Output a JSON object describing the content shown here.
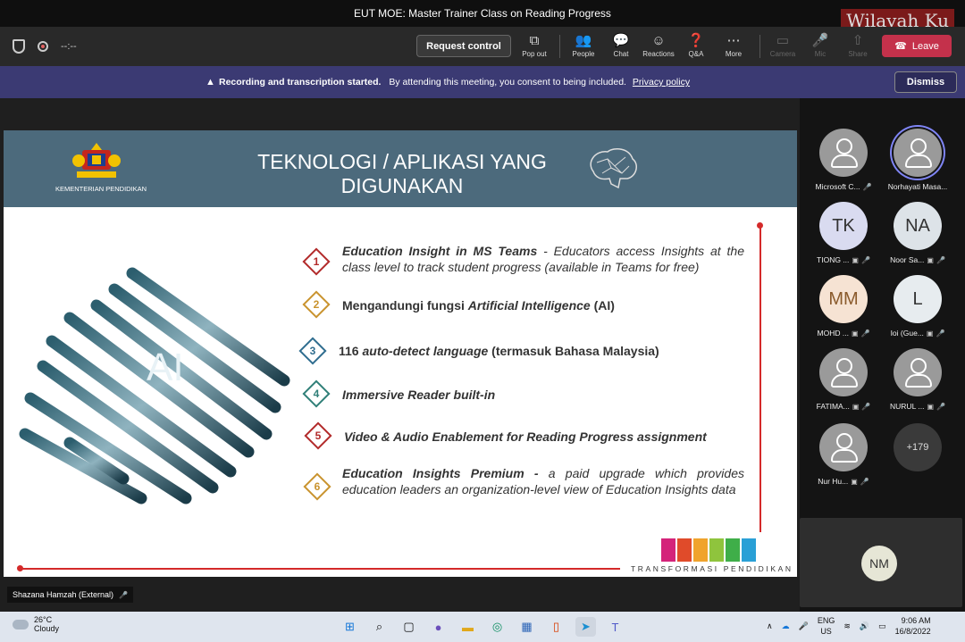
{
  "window": {
    "title": "EUT MOE: Master Trainer Class on Reading Progress",
    "watermark": "Wilayah Ku"
  },
  "toolbar": {
    "timer": "--:--",
    "request_control": "Request control",
    "buttons": [
      {
        "label": "Pop out",
        "icon": "pop-out-icon"
      },
      {
        "label": "People",
        "icon": "people-icon"
      },
      {
        "label": "Chat",
        "icon": "chat-icon"
      },
      {
        "label": "Reactions",
        "icon": "reactions-icon"
      },
      {
        "label": "Q&A",
        "icon": "qa-icon"
      },
      {
        "label": "More",
        "icon": "more-icon"
      },
      {
        "label": "Camera",
        "icon": "camera-off-icon"
      },
      {
        "label": "Mic",
        "icon": "mic-off-icon"
      },
      {
        "label": "Share",
        "icon": "share-icon"
      }
    ],
    "leave": "Leave"
  },
  "banner": {
    "bold": "Recording and transcription started.",
    "text": "By attending this meeting, you consent to being included.",
    "link": "Privacy policy",
    "dismiss": "Dismiss"
  },
  "slide": {
    "ministry": "KEMENTERIAN PENDIDIKAN",
    "title_line1": "TEKNOLOGI / APLIKASI YANG",
    "title_line2": "DIGUNAKAN",
    "art_label": "AI",
    "items": [
      {
        "num": "1",
        "color": "#b22a2a",
        "bold": "Education Insight in MS Teams",
        "rest": " - Educators access Insights at the class level to track student progress (available in Teams for free)"
      },
      {
        "num": "2",
        "color": "#c9932e",
        "pre": "Mengandungi fungsi ",
        "italic": "Artificial Intelligence",
        "post": " (AI)"
      },
      {
        "num": "3",
        "color": "#2f6d8f",
        "pre": "116 ",
        "italic": "auto-detect language",
        "post": " (termasuk Bahasa Malaysia)"
      },
      {
        "num": "4",
        "color": "#2f7f78",
        "text": "Immersive Reader built-in"
      },
      {
        "num": "5",
        "color": "#b22a2a",
        "text": "Video & Audio Enablement for Reading Progress assignment"
      },
      {
        "num": "6",
        "color": "#c9932e",
        "bold": "Education Insights Premium -",
        "rest": " a paid upgrade which provides education leaders an organization-level view of Education Insights data"
      }
    ],
    "footer": "TRANSFORMASI PENDIDIKAN"
  },
  "presenter": "Shazana Hamzah (External)",
  "participants": [
    {
      "initials": "",
      "name": "Microsoft C...",
      "color": "#9a9a9a"
    },
    {
      "initials": "",
      "name": "Norhayati Masa...",
      "color": "#9a9a9a"
    },
    {
      "initials": "TK",
      "name": "TIONG ...",
      "color": "#d9dbf0"
    },
    {
      "initials": "NA",
      "name": "Noor Sa...",
      "color": "#dde3e8"
    },
    {
      "initials": "MM",
      "name": "MOHD ...",
      "color": "#f6e3d3"
    },
    {
      "initials": "L",
      "name": "Ioi (Gue...",
      "color": "#e7ecef"
    },
    {
      "initials": "",
      "name": "FATIMA...",
      "color": "#9a9a9a"
    },
    {
      "initials": "",
      "name": "NURUL ...",
      "color": "#9a9a9a"
    },
    {
      "initials": "",
      "name": "Nur Hu...",
      "color": "#9a9a9a"
    },
    {
      "initials": "+179",
      "name": "",
      "color": "#3a3a3a"
    }
  ],
  "self_view": "NM",
  "taskbar": {
    "temp": "26°C",
    "weather": "Cloudy",
    "lang1": "ENG",
    "lang2": "US",
    "time": "9:06 AM",
    "date": "16/8/2022"
  }
}
